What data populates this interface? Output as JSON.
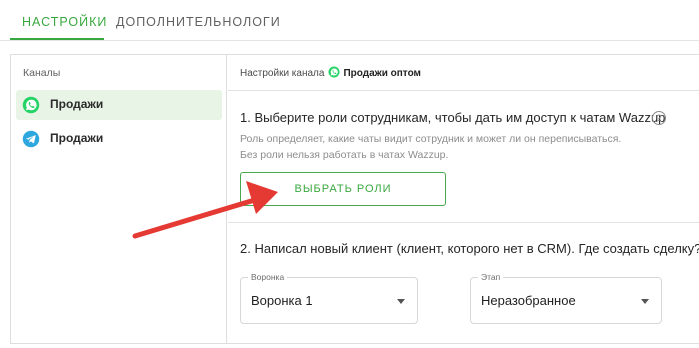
{
  "tabs": [
    {
      "label": "НАСТРОЙКИ",
      "active": true
    },
    {
      "label": "ДОПОЛНИТЕЛЬНО",
      "active": false
    },
    {
      "label": "ЛОГИ",
      "active": false
    }
  ],
  "sidebar": {
    "title": "Каналы",
    "channels": [
      {
        "label": "Продажи",
        "icon": "whatsapp-icon",
        "selected": true
      },
      {
        "label": "Продажи",
        "icon": "telegram-icon",
        "selected": false
      }
    ]
  },
  "content": {
    "breadcrumb_prefix": "Настройки канала",
    "breadcrumb_channel": "Продажи оптом",
    "step1": {
      "title": "1. Выберите роли сотрудникам, чтобы дать им доступ к чатам Wazzup",
      "help_symbol": "?",
      "desc_line1": "Роль определяет, какие чаты видит сотрудник и может ли он переписываться.",
      "desc_line2": "Без роли нельзя работать в чатах Wazzup.",
      "button_label": "ВЫБРАТЬ РОЛИ"
    },
    "step2": {
      "title": "2. Написал новый клиент (клиент, которого нет в CRM). Где создать сделку?",
      "funnel_select": {
        "legend": "Воронка",
        "value": "Воронка 1"
      },
      "stage_select": {
        "legend": "Этап",
        "value": "Неразобранное"
      }
    }
  },
  "colors": {
    "accent_green": "#3aa840",
    "whatsapp_green": "#25d366",
    "telegram_blue": "#2ea6de",
    "arrow_red": "#e53a34"
  }
}
